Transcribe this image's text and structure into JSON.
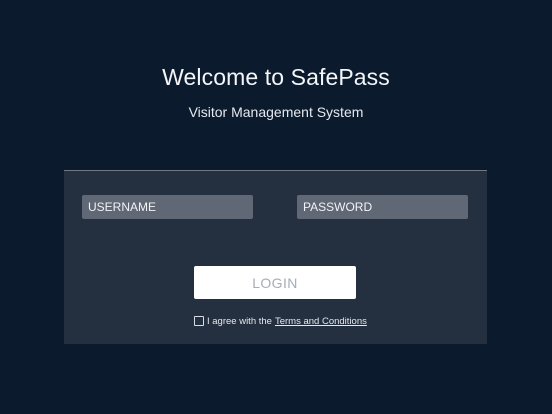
{
  "header": {
    "title": "Welcome to SafePass",
    "subtitle": "Visitor Management System"
  },
  "form": {
    "username_placeholder": "USERNAME",
    "password_placeholder": "PASSWORD",
    "login_label": "LOGIN",
    "agree_text": "I agree with the",
    "terms_link": "Terms and Conditions",
    "agree_checked": false
  },
  "colors": {
    "background": "#0c1a2e",
    "panel": "#242f3f",
    "field": "#5f6874",
    "button": "#ffffff",
    "button_text": "#a7adb5"
  }
}
